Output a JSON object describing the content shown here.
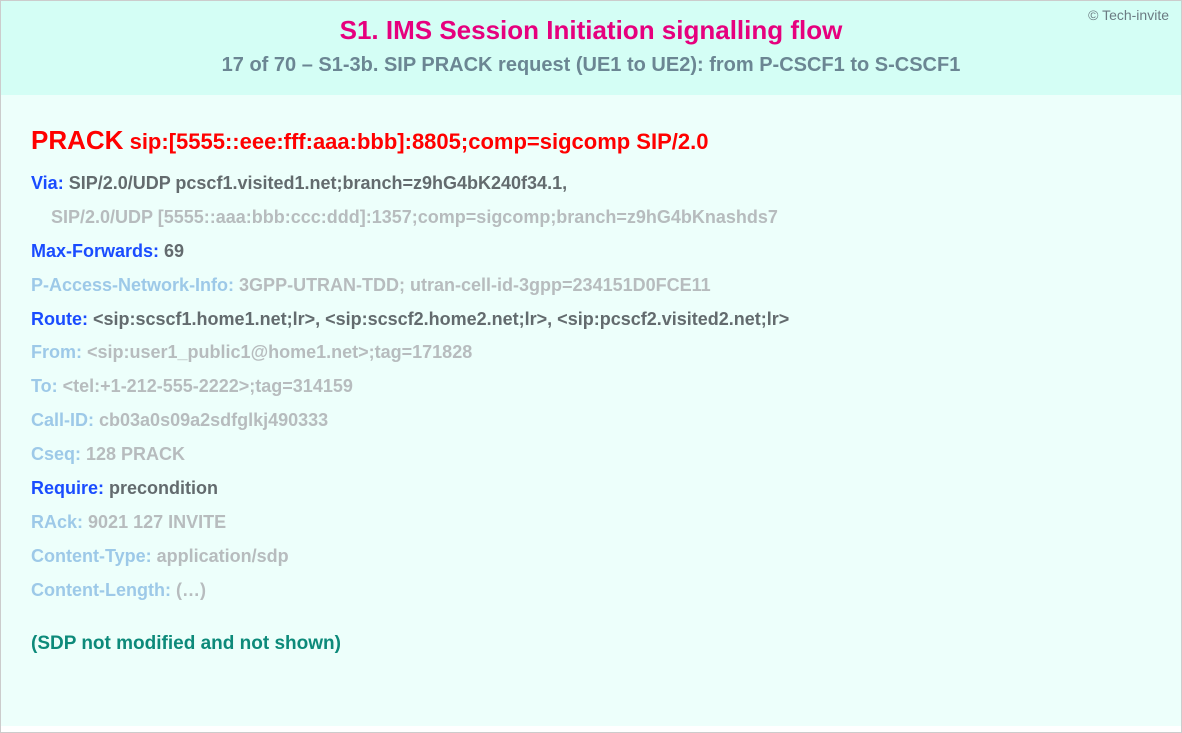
{
  "copyright": "© Tech-invite",
  "title": "S1. IMS Session Initiation signalling flow",
  "subtitle": "17 of 70 – S1-3b. SIP PRACK request (UE1 to UE2): from P-CSCF1 to S-CSCF1",
  "request": {
    "method": "PRACK",
    "uri": "sip:[5555::eee:fff:aaa:bbb]:8805;comp=sigcomp SIP/2.0"
  },
  "headers": {
    "via": {
      "name": "Via",
      "value1": "SIP/2.0/UDP pcscf1.visited1.net;branch=z9hG4bK240f34.1,",
      "value2": "SIP/2.0/UDP [5555::aaa:bbb:ccc:ddd]:1357;comp=sigcomp;branch=z9hG4bKnashds7"
    },
    "maxforwards": {
      "name": "Max-Forwards",
      "value": "69"
    },
    "pani": {
      "name": "P-Access-Network-Info",
      "value": "3GPP-UTRAN-TDD; utran-cell-id-3gpp=234151D0FCE11"
    },
    "route": {
      "name": "Route",
      "value": "<sip:scscf1.home1.net;lr>, <sip:scscf2.home2.net;lr>, <sip:pcscf2.visited2.net;lr>"
    },
    "from": {
      "name": "From",
      "value": "<sip:user1_public1@home1.net>;tag=171828"
    },
    "to": {
      "name": "To",
      "value": "<tel:+1-212-555-2222>;tag=314159"
    },
    "callid": {
      "name": "Call-ID",
      "value": "cb03a0s09a2sdfglkj490333"
    },
    "cseq": {
      "name": "Cseq",
      "value": "128 PRACK"
    },
    "require": {
      "name": "Require",
      "value": "precondition"
    },
    "rack": {
      "name": "RAck",
      "value": "9021 127 INVITE"
    },
    "ctype": {
      "name": "Content-Type",
      "value": "application/sdp"
    },
    "clen": {
      "name": "Content-Length",
      "value": "(…)"
    }
  },
  "footer_note": "(SDP not modified and not shown)"
}
